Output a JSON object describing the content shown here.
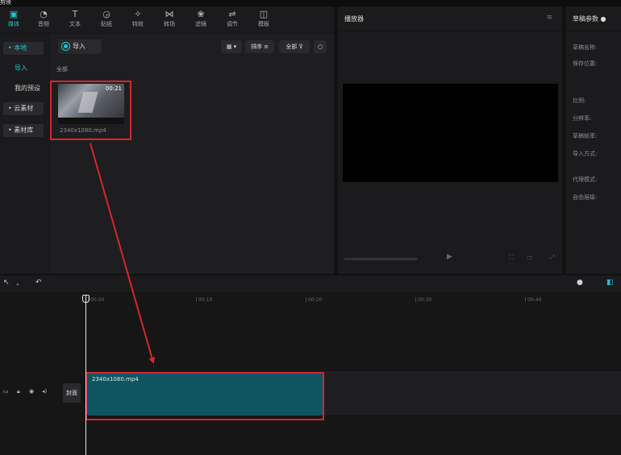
{
  "app": {
    "title_fragment": "剪映"
  },
  "toolbar": {
    "items": [
      {
        "icon": "media-library-icon",
        "glyph": "▣",
        "label": "媒体"
      },
      {
        "icon": "audio-icon",
        "glyph": "◔",
        "label": "音频"
      },
      {
        "icon": "text-icon",
        "glyph": "T",
        "label": "文本"
      },
      {
        "icon": "sticker-icon",
        "glyph": "◶",
        "label": "贴纸"
      },
      {
        "icon": "effects-icon",
        "glyph": "✧",
        "label": "特效"
      },
      {
        "icon": "transition-icon",
        "glyph": "⋈",
        "label": "转场"
      },
      {
        "icon": "filter-icon",
        "glyph": "❀",
        "label": "滤镜"
      },
      {
        "icon": "adjust-icon",
        "glyph": "⇌",
        "label": "调节"
      },
      {
        "icon": "template-icon",
        "glyph": "◫",
        "label": "模板"
      }
    ]
  },
  "sidebar": {
    "items": [
      {
        "label": "• 本地"
      },
      {
        "label": "导入"
      },
      {
        "label": "我的预设"
      },
      {
        "label": "• 云素材"
      },
      {
        "label": "• 素材库"
      }
    ]
  },
  "media": {
    "import_label": "导入",
    "sort_label": "排序",
    "filter_label": "全部",
    "section_label": "全部",
    "clip": {
      "duration": "00:21",
      "filename": "2340x1080.mp4"
    }
  },
  "player": {
    "title": "播放器"
  },
  "details": {
    "title": "草稿参数",
    "rows": [
      "草稿名称:",
      "保存位置:",
      "比例:",
      "分辨率:",
      "草稿帧率:",
      "导入方式:",
      "代理模式:",
      "自由层级:"
    ]
  },
  "timeline": {
    "ticks": [
      "00:00",
      "00:10",
      "00:20",
      "00:30",
      "00:40"
    ],
    "cover_label": "封面",
    "clip_name": "2340x1080.mp4"
  },
  "colors": {
    "accent": "#23c4d4",
    "highlight": "#d9252e",
    "clip": "#0e5561"
  }
}
